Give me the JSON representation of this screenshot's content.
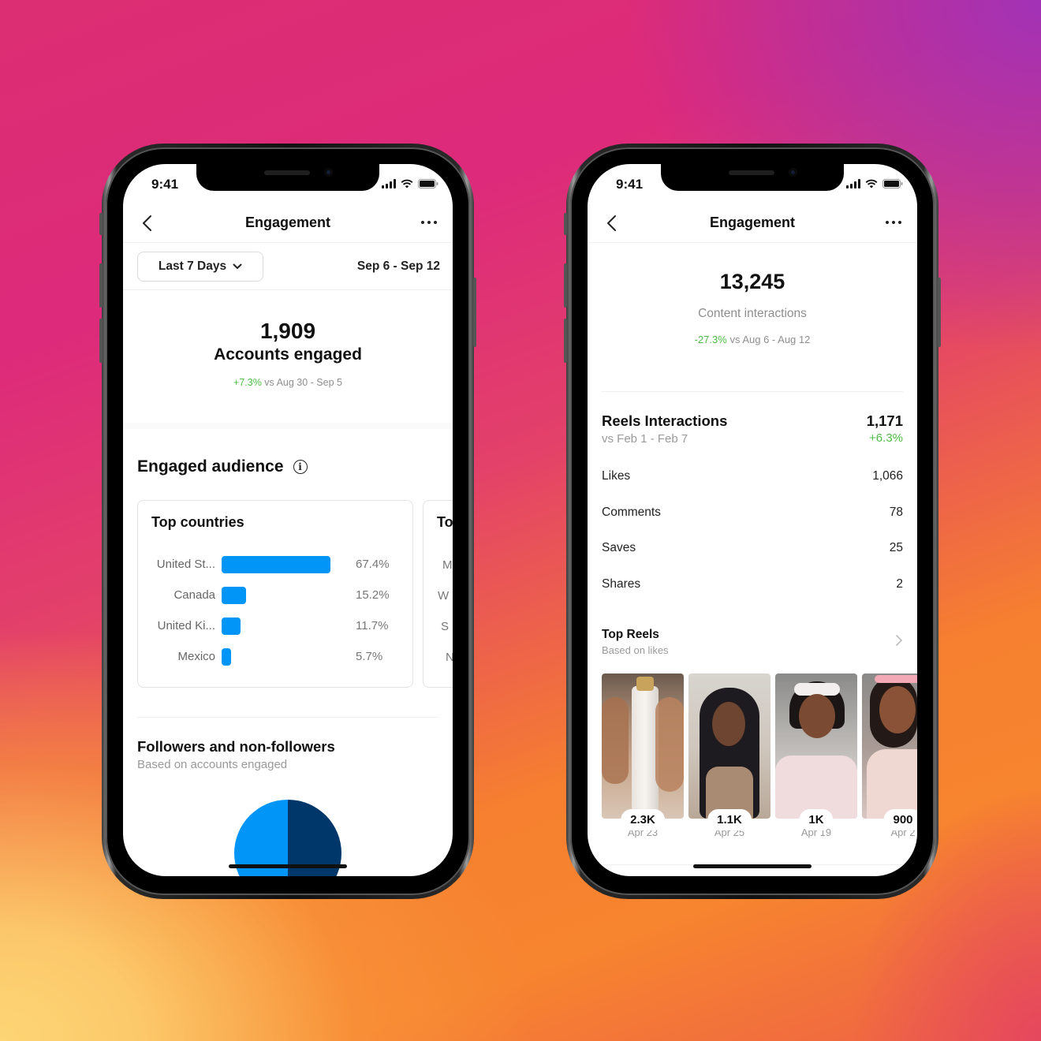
{
  "background": {
    "colors": [
      "#dc2e72",
      "#a232b6",
      "#f7842f",
      "#fdd574"
    ]
  },
  "left_phone": {
    "status_bar": {
      "time": "9:41"
    },
    "nav": {
      "title": "Engagement",
      "back_icon": "chevron-left-icon",
      "more_icon": "more-horizontal-icon"
    },
    "filter": {
      "period_label": "Last 7 Days",
      "date_range": "Sep 6 - Sep 12"
    },
    "summary": {
      "value": "1,909",
      "label": "Accounts engaged",
      "delta": "+7.3%",
      "comparison": "vs Aug 30 - Sep 5"
    },
    "engaged_audience": {
      "title": "Engaged audience",
      "top_countries": {
        "title": "Top countries",
        "rows": [
          {
            "label": "United St...",
            "value": "67.4%",
            "share": 67.4
          },
          {
            "label": "Canada",
            "value": "15.2%",
            "share": 15.2
          },
          {
            "label": "United Ki...",
            "value": "11.7%",
            "share": 11.7
          },
          {
            "label": "Mexico",
            "value": "5.7%",
            "share": 5.7
          }
        ]
      },
      "peek_card": {
        "title": "To",
        "rows": [
          "M",
          "W",
          "S",
          "N"
        ]
      }
    },
    "followers": {
      "title": "Followers and non-followers",
      "subtitle": "Based on accounts engaged",
      "pie": {
        "followers_share": 50,
        "non_followers_share": 50,
        "colors": [
          "#0095f6",
          "#00376b"
        ]
      }
    },
    "bar_color": "#0095f6"
  },
  "right_phone": {
    "status_bar": {
      "time": "9:41"
    },
    "nav": {
      "title": "Engagement",
      "back_icon": "chevron-left-icon",
      "more_icon": "more-horizontal-icon"
    },
    "summary": {
      "value": "13,245",
      "label": "Content interactions",
      "delta": "-27.3%",
      "comparison": "vs Aug 6 - Aug 12"
    },
    "reels_interactions": {
      "title": "Reels Interactions",
      "comparison": "vs Feb 1 - Feb 7",
      "value": "1,171",
      "delta": "+6.3%"
    },
    "metrics": [
      {
        "label": "Likes",
        "value": "1,066"
      },
      {
        "label": "Comments",
        "value": "78"
      },
      {
        "label": "Saves",
        "value": "25"
      },
      {
        "label": "Shares",
        "value": "2"
      }
    ],
    "top_reels": {
      "title": "Top Reels",
      "subtitle": "Based on likes",
      "items": [
        {
          "count": "2.3K",
          "date": "Apr 23"
        },
        {
          "count": "1.1K",
          "date": "Apr 25"
        },
        {
          "count": "1K",
          "date": "Apr 19"
        },
        {
          "count": "900",
          "date": "Apr 2"
        }
      ]
    }
  },
  "accent_green": "#4fbc46"
}
